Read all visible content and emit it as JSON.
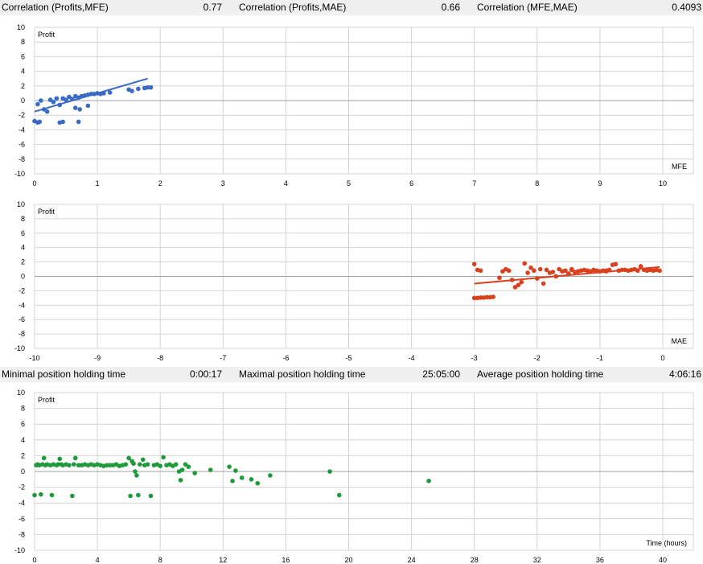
{
  "header_top": {
    "items": [
      {
        "label": "Correlation (Profits,MFE)",
        "value": "0.77"
      },
      {
        "label": "Correlation (Profits,MAE)",
        "value": "0.66"
      },
      {
        "label": "Correlation (MFE,MAE)",
        "value": "0.4093"
      }
    ]
  },
  "header_mid": {
    "items": [
      {
        "label": "Minimal position holding time",
        "value": "0:00:17"
      },
      {
        "label": "Maximal position holding time",
        "value": "25:05:00"
      },
      {
        "label": "Average position holding time",
        "value": "4:06:16"
      }
    ]
  },
  "colors": {
    "mfe": "#3a6bc4",
    "mae": "#d9411e",
    "time": "#1e9a3a",
    "grid": "#d4d4d4",
    "zero": "#a0a0a0"
  },
  "chart_data": [
    {
      "type": "scatter",
      "ylabel": "Profit",
      "xlabel": "MFE",
      "xlim": [
        0,
        10
      ],
      "ylim": [
        -10,
        10
      ],
      "xticks": [
        "0",
        "1",
        "2",
        "3",
        "4",
        "5",
        "6",
        "7",
        "8",
        "9",
        "10"
      ],
      "yticks": [
        "10",
        "8",
        "6",
        "4",
        "2",
        "0",
        "-2",
        "-4",
        "-6",
        "-8",
        "-10"
      ],
      "trendline": [
        [
          0,
          -1.5
        ],
        [
          1.8,
          3.0
        ]
      ],
      "points": [
        [
          0.0,
          -2.8
        ],
        [
          0.05,
          -3.0
        ],
        [
          0.08,
          -2.9
        ],
        [
          0.05,
          -0.5
        ],
        [
          0.1,
          0.0
        ],
        [
          0.15,
          -1.2
        ],
        [
          0.2,
          -1.5
        ],
        [
          0.25,
          0.1
        ],
        [
          0.3,
          -0.2
        ],
        [
          0.35,
          0.3
        ],
        [
          0.4,
          -0.6
        ],
        [
          0.45,
          0.3
        ],
        [
          0.5,
          0.1
        ],
        [
          0.4,
          -3.0
        ],
        [
          0.45,
          -2.9
        ],
        [
          0.55,
          0.5
        ],
        [
          0.6,
          0.2
        ],
        [
          0.65,
          0.6
        ],
        [
          0.65,
          -1.0
        ],
        [
          0.7,
          0.4
        ],
        [
          0.7,
          -2.9
        ],
        [
          0.72,
          -1.2
        ],
        [
          0.75,
          0.6
        ],
        [
          0.8,
          0.7
        ],
        [
          0.85,
          0.8
        ],
        [
          0.85,
          -0.7
        ],
        [
          0.9,
          0.9
        ],
        [
          0.95,
          0.9
        ],
        [
          1.0,
          1.0
        ],
        [
          1.05,
          0.9
        ],
        [
          1.1,
          1.0
        ],
        [
          1.2,
          1.1
        ],
        [
          1.5,
          1.5
        ],
        [
          1.55,
          1.3
        ],
        [
          1.65,
          1.6
        ],
        [
          1.75,
          1.7
        ],
        [
          1.8,
          1.8
        ],
        [
          1.85,
          1.8
        ]
      ]
    },
    {
      "type": "scatter",
      "ylabel": "Profit",
      "xlabel": "MAE",
      "xlim": [
        -10,
        0
      ],
      "ylim": [
        -10,
        10
      ],
      "xticks": [
        "-10",
        "-9",
        "-8",
        "-7",
        "-6",
        "-5",
        "-4",
        "-3",
        "-2",
        "-1",
        "0"
      ],
      "yticks": [
        "10",
        "8",
        "6",
        "4",
        "2",
        "0",
        "-2",
        "-4",
        "-6",
        "-8",
        "-10"
      ],
      "trendline": [
        [
          -3.0,
          -1.0
        ],
        [
          -0.05,
          1.3
        ]
      ],
      "points": [
        [
          -3.0,
          -3.0
        ],
        [
          -2.95,
          -3.0
        ],
        [
          -2.9,
          -2.95
        ],
        [
          -2.85,
          -2.95
        ],
        [
          -2.8,
          -2.9
        ],
        [
          -2.75,
          -2.9
        ],
        [
          -2.7,
          -2.85
        ],
        [
          -3.0,
          1.7
        ],
        [
          -2.95,
          0.9
        ],
        [
          -2.9,
          0.8
        ],
        [
          -2.6,
          -0.2
        ],
        [
          -2.55,
          0.7
        ],
        [
          -2.5,
          1.0
        ],
        [
          -2.45,
          0.8
        ],
        [
          -2.4,
          -0.5
        ],
        [
          -2.35,
          -1.5
        ],
        [
          -2.3,
          -1.2
        ],
        [
          -2.25,
          -0.8
        ],
        [
          -2.2,
          1.8
        ],
        [
          -2.15,
          0.5
        ],
        [
          -2.1,
          1.2
        ],
        [
          -2.05,
          0.8
        ],
        [
          -2.0,
          -0.3
        ],
        [
          -1.95,
          1.0
        ],
        [
          -1.9,
          -1.0
        ],
        [
          -1.85,
          0.9
        ],
        [
          -1.8,
          0.5
        ],
        [
          -1.75,
          0.6
        ],
        [
          -1.7,
          0.0
        ],
        [
          -1.65,
          1.0
        ],
        [
          -1.6,
          0.7
        ],
        [
          -1.55,
          0.8
        ],
        [
          -1.5,
          0.4
        ],
        [
          -1.45,
          0.9
        ],
        [
          -1.4,
          0.6
        ],
        [
          -1.35,
          0.7
        ],
        [
          -1.3,
          0.8
        ],
        [
          -1.25,
          0.9
        ],
        [
          -1.2,
          0.8
        ],
        [
          -1.15,
          0.7
        ],
        [
          -1.1,
          0.9
        ],
        [
          -1.05,
          0.8
        ],
        [
          -1.0,
          0.7
        ],
        [
          -0.95,
          0.8
        ],
        [
          -0.9,
          0.8
        ],
        [
          -0.85,
          0.9
        ],
        [
          -0.8,
          1.6
        ],
        [
          -0.75,
          1.7
        ],
        [
          -0.7,
          0.8
        ],
        [
          -0.65,
          0.9
        ],
        [
          -0.6,
          0.9
        ],
        [
          -0.55,
          0.8
        ],
        [
          -0.5,
          0.9
        ],
        [
          -0.45,
          1.0
        ],
        [
          -0.4,
          0.8
        ],
        [
          -0.35,
          1.4
        ],
        [
          -0.3,
          0.9
        ],
        [
          -0.25,
          0.8
        ],
        [
          -0.2,
          0.9
        ],
        [
          -0.15,
          0.8
        ],
        [
          -0.1,
          0.9
        ],
        [
          -0.05,
          0.8
        ],
        [
          -1.45,
          1.0
        ],
        [
          -0.9,
          0.7
        ]
      ]
    },
    {
      "type": "scatter",
      "ylabel": "Profit",
      "xlabel": "Time (hours)",
      "xlim": [
        0,
        40
      ],
      "ylim": [
        -10,
        10
      ],
      "xticks": [
        "0",
        "4",
        "8",
        "12",
        "16",
        "20",
        "24",
        "28",
        "32",
        "36",
        "40"
      ],
      "yticks": [
        "10",
        "8",
        "6",
        "4",
        "2",
        "0",
        "-2",
        "-4",
        "-6",
        "-8",
        "-10"
      ],
      "points": [
        [
          0.0,
          -3.0
        ],
        [
          0.1,
          0.8
        ],
        [
          0.2,
          0.9
        ],
        [
          0.3,
          0.8
        ],
        [
          0.4,
          -2.9
        ],
        [
          0.5,
          0.9
        ],
        [
          0.6,
          1.7
        ],
        [
          0.7,
          0.8
        ],
        [
          0.8,
          0.9
        ],
        [
          1.0,
          0.8
        ],
        [
          1.1,
          -3.0
        ],
        [
          1.2,
          0.9
        ],
        [
          1.4,
          0.8
        ],
        [
          1.5,
          0.9
        ],
        [
          1.6,
          1.6
        ],
        [
          1.7,
          0.9
        ],
        [
          1.8,
          0.8
        ],
        [
          2.0,
          0.9
        ],
        [
          2.2,
          0.8
        ],
        [
          2.4,
          -3.1
        ],
        [
          2.5,
          0.9
        ],
        [
          2.6,
          1.7
        ],
        [
          2.8,
          0.8
        ],
        [
          3.0,
          0.8
        ],
        [
          3.2,
          0.9
        ],
        [
          3.4,
          0.8
        ],
        [
          3.6,
          0.9
        ],
        [
          3.8,
          0.8
        ],
        [
          4.0,
          0.9
        ],
        [
          4.2,
          0.8
        ],
        [
          4.4,
          0.7
        ],
        [
          4.6,
          0.8
        ],
        [
          4.8,
          0.8
        ],
        [
          5.0,
          0.8
        ],
        [
          5.2,
          0.9
        ],
        [
          5.4,
          0.7
        ],
        [
          5.6,
          0.8
        ],
        [
          5.8,
          0.9
        ],
        [
          6.0,
          1.7
        ],
        [
          6.1,
          -3.1
        ],
        [
          6.2,
          1.3
        ],
        [
          6.3,
          1.0
        ],
        [
          6.4,
          0.0
        ],
        [
          6.5,
          -0.5
        ],
        [
          6.6,
          -3.0
        ],
        [
          6.7,
          0.9
        ],
        [
          6.9,
          1.5
        ],
        [
          7.0,
          0.8
        ],
        [
          7.2,
          0.9
        ],
        [
          7.4,
          -3.1
        ],
        [
          7.6,
          0.8
        ],
        [
          7.8,
          0.9
        ],
        [
          8.0,
          0.7
        ],
        [
          8.2,
          1.8
        ],
        [
          8.4,
          0.8
        ],
        [
          8.6,
          0.9
        ],
        [
          8.8,
          0.7
        ],
        [
          9.0,
          0.9
        ],
        [
          9.2,
          0.0
        ],
        [
          9.3,
          -1.1
        ],
        [
          9.4,
          0.2
        ],
        [
          9.6,
          0.9
        ],
        [
          9.8,
          0.6
        ],
        [
          10.2,
          -0.2
        ],
        [
          11.2,
          0.2
        ],
        [
          12.4,
          0.6
        ],
        [
          12.6,
          -1.2
        ],
        [
          12.8,
          0.1
        ],
        [
          13.2,
          -0.8
        ],
        [
          13.8,
          -1.0
        ],
        [
          14.2,
          -1.5
        ],
        [
          15.0,
          -0.5
        ],
        [
          18.8,
          0.0
        ],
        [
          19.4,
          -3.0
        ],
        [
          25.1,
          -1.2
        ]
      ]
    }
  ]
}
